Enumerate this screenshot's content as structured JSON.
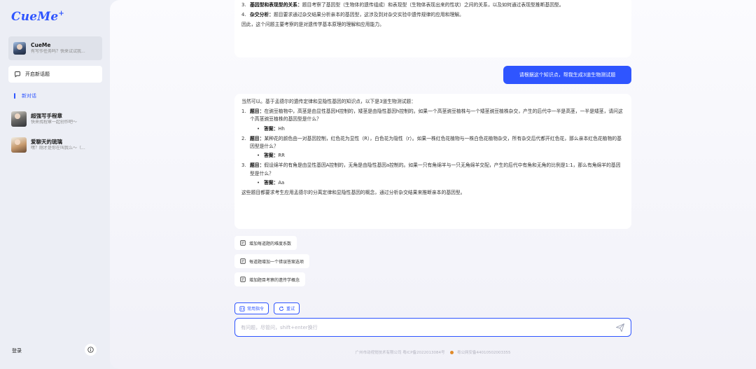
{
  "brand": {
    "logo": "CueMe",
    "logo_plus": "+"
  },
  "sidebar": {
    "assistant": {
      "name": "CueMe",
      "subtitle": "有写作任务吗？快来试试我..."
    },
    "new_topic_label": "开启新话题",
    "current_conversation": "新对话",
    "conversations": [
      {
        "title": "超强写手程章",
        "subtitle": "快来找程章一起创作吧～"
      },
      {
        "title": "爱聊天的琉璃",
        "subtitle": "嘿？刚才是你在叫我么～（..."
      }
    ],
    "login_label": "登录",
    "info_icon": "info-icon"
  },
  "chat": {
    "top_message": {
      "item3": {
        "num": "3.",
        "label": "基因型和表现型的关系：",
        "text": "题目考察了基因型（生物体的遗传组成）和表现型（生物体表现出来的性状）之间的关系，以及如何通过表现型推断基因型。"
      },
      "item4": {
        "num": "4.",
        "label": "杂交分析：",
        "text": "题目要求通过杂交结果分析亲本的基因型，这涉及到对杂交实验中遗传规律的应用和理解。"
      },
      "conclusion": "因此，这个问题主要考察的是对遗传学基本原理的理解和应用能力。"
    },
    "user_message": "请根据这个知识点，帮我生成3道生物测试题",
    "ai_message": {
      "intro": "当然可以。基于孟德尔的遗传定律和显隐性基因的知识点，以下是3道生物测试题：",
      "questions": [
        {
          "num": "1.",
          "label": "题目：",
          "text": "在豌豆植物中，高茎是由显性基因H控制的，矮茎是由隐性基因h控制的。如果一个高茎豌豆植株与一个矮茎豌豆植株杂交，产生的后代中一半是高茎，一半是矮茎，请问这个高茎豌豆植株的基因型是什么？",
          "answer_label": "答案：",
          "answer": "Hh"
        },
        {
          "num": "2.",
          "label": "题目：",
          "text": "某种花的颜色由一对基因控制，红色花为显性（R），白色花为隐性（r）。如果一株红色花植物与一株白色花植物杂交，所有杂交后代都开红色花，那么亲本红色花植物的基因型是什么？",
          "answer_label": "答案：",
          "answer": "RR"
        },
        {
          "num": "3.",
          "label": "题目：",
          "text": "假设绵羊的有角是由显性基因A控制的，无角是由隐性基因a控制的。如果一只有角绵羊与一只无角绵羊交配，产生的后代中有角和无角的比例是1:1，那么有角绵羊的基因型是什么？",
          "answer_label": "答案：",
          "answer": "Aa"
        }
      ],
      "conclusion": "这些题目都要求考生应用孟德尔的分离定律和显隐性基因的概念，通过分析杂交结果来推断亲本的基因型。"
    },
    "suggestions": [
      "增加每道题的难度系数",
      "每道题增加一个错误答案选项",
      "增加题目考察的遗传学概念"
    ],
    "chips": {
      "common_commands": "常用指令",
      "retry": "重试"
    },
    "input": {
      "placeholder": "有问题，尽管问，shift+enter换行",
      "value": ""
    },
    "footer": {
      "company": "广州市动视觉技术有限公司 粤ICP备2022013084号",
      "police": "粤公网安备44010502003355"
    }
  },
  "colors": {
    "accent": "#2f55ff",
    "sidebar_bg": "#eceef5",
    "card_bg": "#ffffff"
  }
}
